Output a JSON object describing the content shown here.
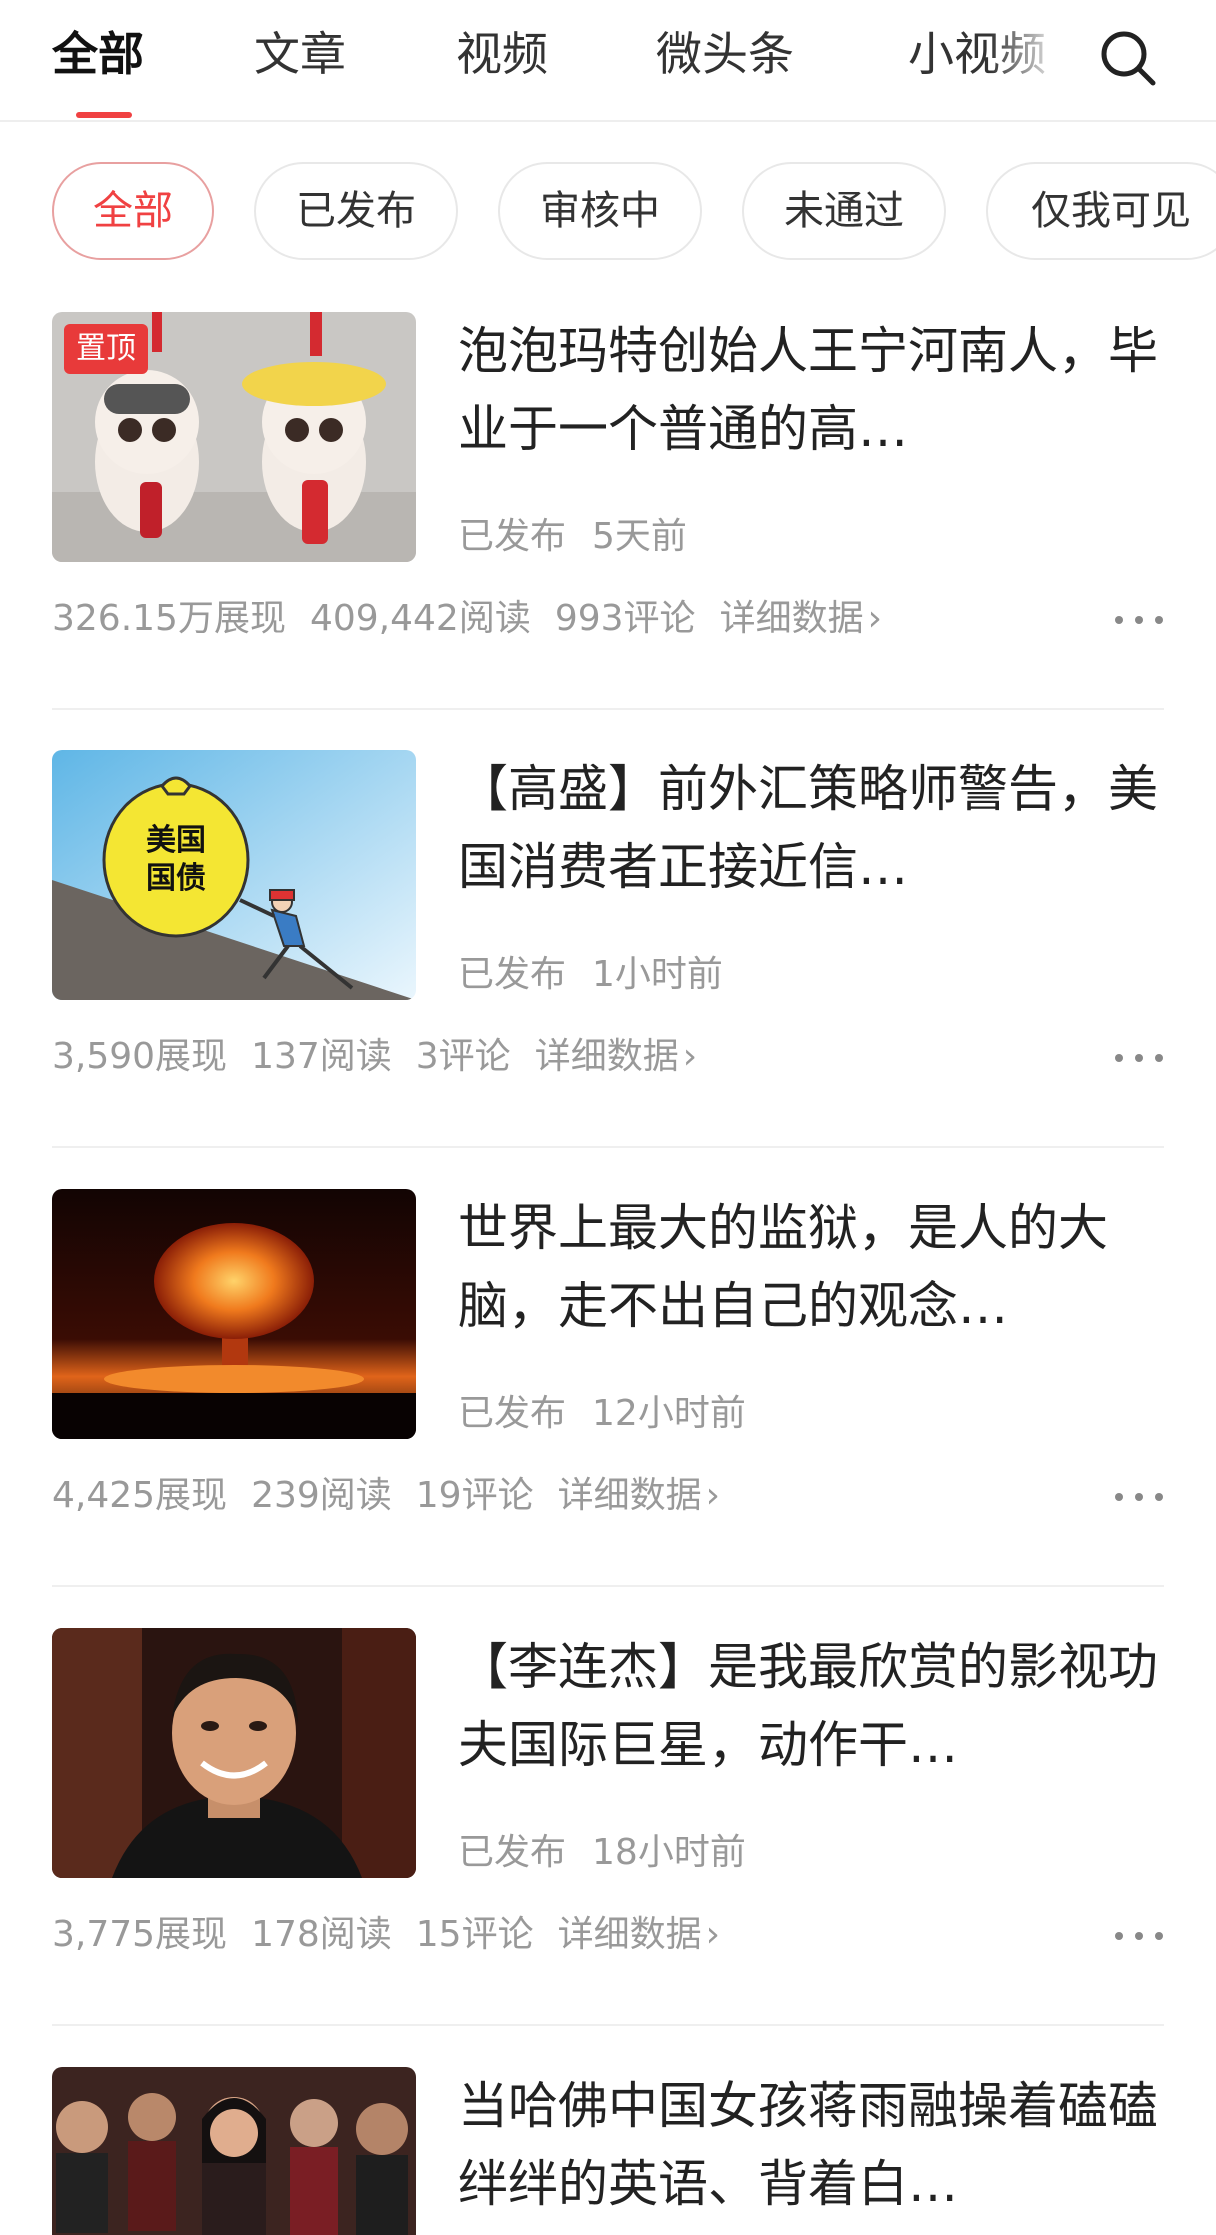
{
  "tabs": {
    "items": [
      "全部",
      "文章",
      "视频",
      "微头条",
      "小视频"
    ],
    "active_index": 0
  },
  "filters": {
    "items": [
      "全部",
      "已发布",
      "审核中",
      "未通过",
      "仅我可见"
    ],
    "active_index": 0
  },
  "theme": {
    "accent": "#f04142",
    "muted_text": "#999999"
  },
  "feed": [
    {
      "pinned": true,
      "pin_label": "置顶",
      "title": "泡泡玛特创始人王宁河南人，毕业于一个普通的高…",
      "status": "已发布",
      "time": "5天前",
      "impressions": "326.15万展现",
      "reads": "409,442阅读",
      "comments": "993评论",
      "detail_label": "详细数据",
      "thumb_icon": "plush-toy-image"
    },
    {
      "pinned": false,
      "title": "【高盛】前外汇策略师警告，美国消费者正接近信…",
      "status": "已发布",
      "time": "1小时前",
      "impressions": "3,590展现",
      "reads": "137阅读",
      "comments": "3评论",
      "detail_label": "详细数据",
      "thumb_icon": "cartoon-debt-bag-image",
      "thumb_text": [
        "美国",
        "国债"
      ]
    },
    {
      "pinned": false,
      "title": "世界上最大的监狱，是人的大脑，走不出自己的观念…",
      "status": "已发布",
      "time": "12小时前",
      "impressions": "4,425展现",
      "reads": "239阅读",
      "comments": "19评论",
      "detail_label": "详细数据",
      "thumb_icon": "explosion-image"
    },
    {
      "pinned": false,
      "title": "【李连杰】是我最欣赏的影视功夫国际巨星，动作干…",
      "status": "已发布",
      "time": "18小时前",
      "impressions": "3,775展现",
      "reads": "178阅读",
      "comments": "15评论",
      "detail_label": "详细数据",
      "thumb_icon": "portrait-image"
    },
    {
      "pinned": false,
      "title": "当哈佛中国女孩蒋雨融操着磕磕绊绊的英语、背着白…",
      "thumb_icon": "audience-image"
    }
  ]
}
